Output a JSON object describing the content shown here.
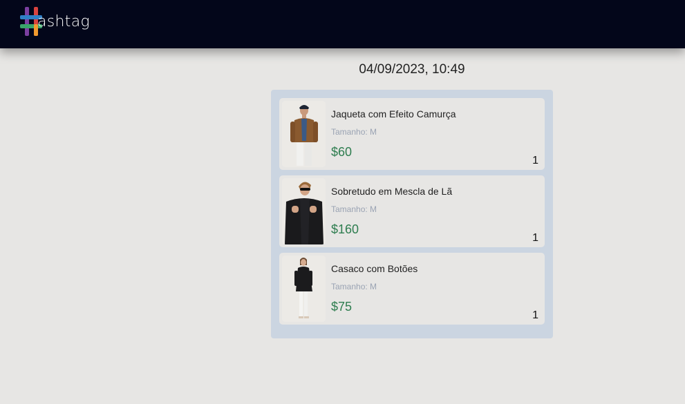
{
  "header": {
    "logo_text": "ashtag",
    "logo_icon": "hashtag-logo-icon"
  },
  "order": {
    "datetime": "04/09/2023, 10:49",
    "items": [
      {
        "name": "Jaqueta com Efeito Camurça",
        "size": "Tamanho: M",
        "price": "$60",
        "quantity": "1",
        "image": "brown-suede-jacket-photo"
      },
      {
        "name": "Sobretudo em Mescla de Lã",
        "size": "Tamanho: M",
        "price": "$160",
        "quantity": "1",
        "image": "black-wool-overcoat-photo"
      },
      {
        "name": "Casaco com Botões",
        "size": "Tamanho: M",
        "price": "$75",
        "quantity": "1",
        "image": "black-buttoned-coat-photo"
      }
    ]
  },
  "colors": {
    "header_bg": "#03061a",
    "page_bg": "#e7e6e4",
    "panel_bg": "#cbd5e1",
    "price": "#2e7d4f",
    "size_text": "#9aa3b3"
  }
}
